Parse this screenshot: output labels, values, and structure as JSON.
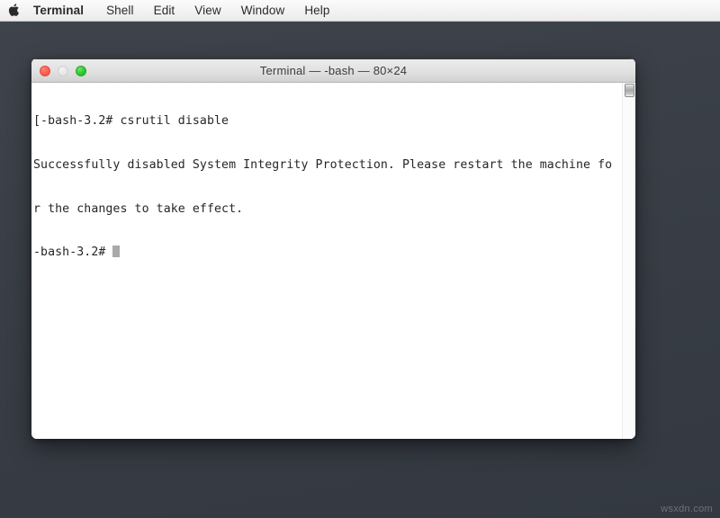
{
  "menubar": {
    "apple_icon": "apple-logo-icon",
    "items": [
      {
        "label": "Terminal",
        "active": true
      },
      {
        "label": "Shell",
        "active": false
      },
      {
        "label": "Edit",
        "active": false
      },
      {
        "label": "View",
        "active": false
      },
      {
        "label": "Window",
        "active": false
      },
      {
        "label": "Help",
        "active": false
      }
    ]
  },
  "window": {
    "title": "Terminal — -bash — 80×24",
    "controls": {
      "close": "close-button",
      "minimize": "minimize-button",
      "zoom": "zoom-button"
    }
  },
  "terminal": {
    "lines": [
      "[-bash-3.2# csrutil disable",
      "Successfully disabled System Integrity Protection. Please restart the machine fo",
      "r the changes to take effect.",
      "-bash-3.2# "
    ],
    "line1_right_bracket": "]",
    "prompt": "-bash-3.2#",
    "command": "csrutil disable",
    "cursor_visible": true
  },
  "desktop": {
    "watermark": "wsxdn.com",
    "background_color": "#3b4048"
  },
  "colors": {
    "close_red": "#fb5f52",
    "minimize_gray": "#e6e6e6",
    "zoom_green": "#2ec82e",
    "terminal_bg": "#ffffff",
    "terminal_text": "#262626",
    "menubar_bg": "#f2f2f2"
  }
}
